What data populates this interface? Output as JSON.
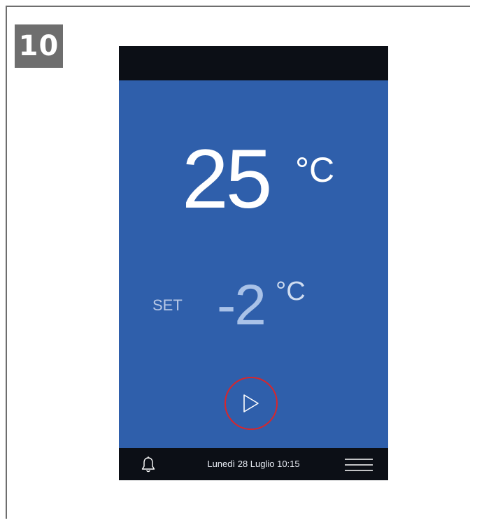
{
  "step": {
    "number": "10"
  },
  "display": {
    "current_temp": "25",
    "current_unit": "°C",
    "set_label": "SET",
    "set_temp": "-2",
    "set_unit": "°C"
  },
  "footer": {
    "datetime": "Lunedì 28 Luglio 10:15"
  },
  "icons": {
    "play": "play-icon",
    "bell": "bell-icon",
    "menu": "hamburger-menu-icon"
  },
  "colors": {
    "screen_background": "#2f5fab",
    "bars": "#0c0f16",
    "play_ring": "#d9262b",
    "badge": "#6e6e6e"
  }
}
